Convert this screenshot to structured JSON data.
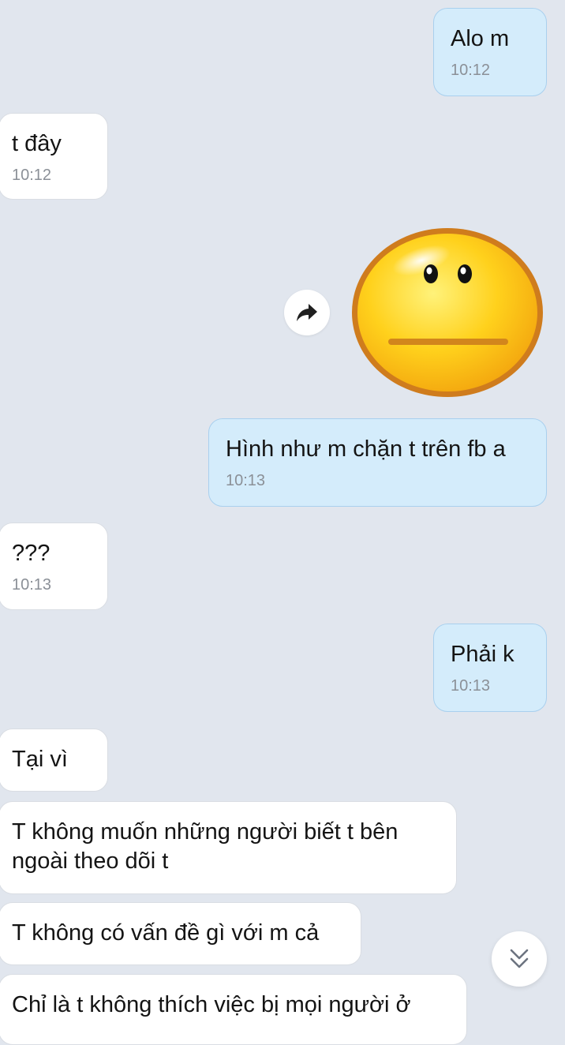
{
  "messages": [
    {
      "text": "Alo m",
      "time": "10:12"
    },
    {
      "text": "t đây",
      "time": "10:12"
    },
    {
      "text": "Hình như m chặn t trên fb a",
      "time": "10:13"
    },
    {
      "text": "???",
      "time": "10:13"
    },
    {
      "text": "Phải k",
      "time": "10:13"
    },
    {
      "text": "Tại vì"
    },
    {
      "text": "T không muốn những người biết t bên\nngoài theo dõi t"
    },
    {
      "text": "T không có vấn đề gì với m cả"
    },
    {
      "text": "Chỉ là t không thích việc bị mọi người ở"
    }
  ],
  "icons": {
    "sticker": "neutral-face-sticker",
    "forward": "forward-arrow-icon",
    "scroll_down": "double-chevron-down-icon"
  },
  "colors": {
    "background": "#e1e6ee",
    "incoming_bubble": "#ffffff",
    "outgoing_bubble": "#d4ecfb",
    "outgoing_border": "#a9d0ee",
    "time_text": "#8b9097"
  }
}
